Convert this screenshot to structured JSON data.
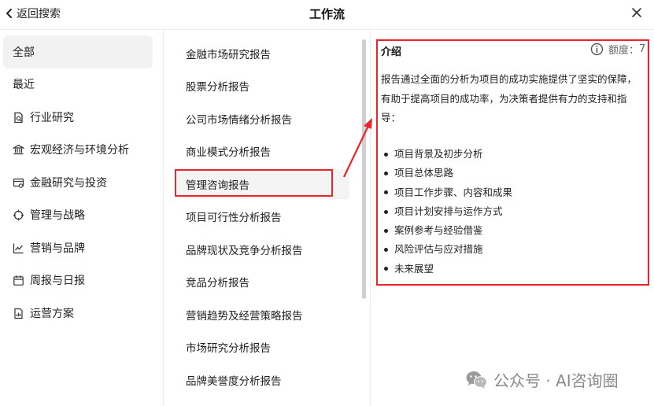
{
  "header": {
    "back_label": "返回搜索",
    "title": "工作流"
  },
  "sidebar": {
    "items": [
      {
        "label": "全部",
        "icon": "none",
        "active": true
      },
      {
        "label": "最近",
        "icon": "none",
        "active": false
      },
      {
        "label": "行业研究",
        "icon": "document-search-icon",
        "active": false
      },
      {
        "label": "宏观经济与环境分析",
        "icon": "bank-icon",
        "active": false
      },
      {
        "label": "金融研究与投资",
        "icon": "finance-card-icon",
        "active": false
      },
      {
        "label": "管理与战略",
        "icon": "target-icon",
        "active": false
      },
      {
        "label": "营销与品牌",
        "icon": "trend-chart-icon",
        "active": false
      },
      {
        "label": "周报与日报",
        "icon": "calendar-icon",
        "active": false
      },
      {
        "label": "运营方案",
        "icon": "report-icon",
        "active": false
      }
    ]
  },
  "workflows": {
    "items": [
      {
        "label": "金融市场研究报告"
      },
      {
        "label": "股票分析报告"
      },
      {
        "label": "公司市场情绪分析报告"
      },
      {
        "label": "商业模式分析报告"
      },
      {
        "label": "管理咨询报告",
        "selected": true
      },
      {
        "label": "项目可行性分析报告"
      },
      {
        "label": "品牌现状及竞争分析报告"
      },
      {
        "label": "竞品分析报告"
      },
      {
        "label": "营销趋势及经营策略报告"
      },
      {
        "label": "市场研究分析报告"
      },
      {
        "label": "品牌美誉度分析报告"
      }
    ]
  },
  "intro": {
    "title": "介绍",
    "quota_label": "额度：",
    "quota_value": "7",
    "description": "报告通过全面的分析为项目的成功实施提供了坚实的保障，有助于提高项目的成功率，为决策者提供有力的支持和指导：",
    "bullets": [
      "项目背景及初步分析",
      "项目总体思路",
      "项目工作步骤、内容和成果",
      "项目计划安排与运作方式",
      "案例参考与经验借鉴",
      "风险评估与应对措施",
      "未来展望"
    ]
  },
  "watermark": {
    "text": "公众号 · AI咨询圈",
    "icon": "wechat-icon"
  },
  "colors": {
    "highlight_red": "#e8262b",
    "active_bg": "#f2f2f2"
  }
}
